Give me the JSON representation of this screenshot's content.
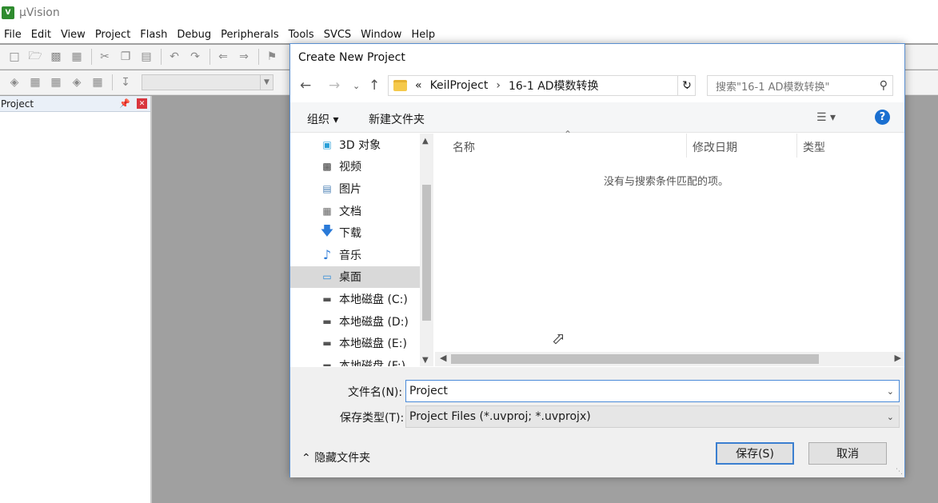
{
  "app": {
    "logo_text": "V",
    "title": "µVision",
    "menu": [
      "File",
      "Edit",
      "View",
      "Project",
      "Flash",
      "Debug",
      "Peripherals",
      "Tools",
      "SVCS",
      "Window",
      "Help"
    ],
    "project_panel": {
      "title": "Project"
    }
  },
  "dialog": {
    "title": "Create New Project",
    "address": {
      "overflow": "«",
      "crumbs": [
        "KeilProject",
        "16-1 AD模数转换"
      ],
      "sep": "›"
    },
    "search_placeholder": "搜索\"16-1 AD模数转换\"",
    "commands": {
      "organize": "组织 ▾",
      "new_folder": "新建文件夹"
    },
    "nav_items": [
      {
        "label": "3D 对象",
        "icon": "cube-icon"
      },
      {
        "label": "视频",
        "icon": "video-icon"
      },
      {
        "label": "图片",
        "icon": "picture-icon"
      },
      {
        "label": "文档",
        "icon": "document-icon"
      },
      {
        "label": "下载",
        "icon": "download-icon"
      },
      {
        "label": "音乐",
        "icon": "music-icon"
      },
      {
        "label": "桌面",
        "icon": "desktop-icon",
        "selected": true
      },
      {
        "label": "本地磁盘 (C:)",
        "icon": "drive-icon"
      },
      {
        "label": "本地磁盘 (D:)",
        "icon": "drive-icon"
      },
      {
        "label": "本地磁盘 (E:)",
        "icon": "drive-icon"
      },
      {
        "label": "本地磁盘 (F:)",
        "icon": "drive-icon"
      }
    ],
    "columns": {
      "name": "名称",
      "modified": "修改日期",
      "type": "类型"
    },
    "empty_message": "没有与搜索条件匹配的项。",
    "filename_label": "文件名(N):",
    "filename_value": "Project",
    "filetype_label": "保存类型(T):",
    "filetype_value": "Project Files (*.uvproj; *.uvprojx)",
    "hide_folders": "隐藏文件夹",
    "save_button": "保存(S)",
    "cancel_button": "取消"
  }
}
